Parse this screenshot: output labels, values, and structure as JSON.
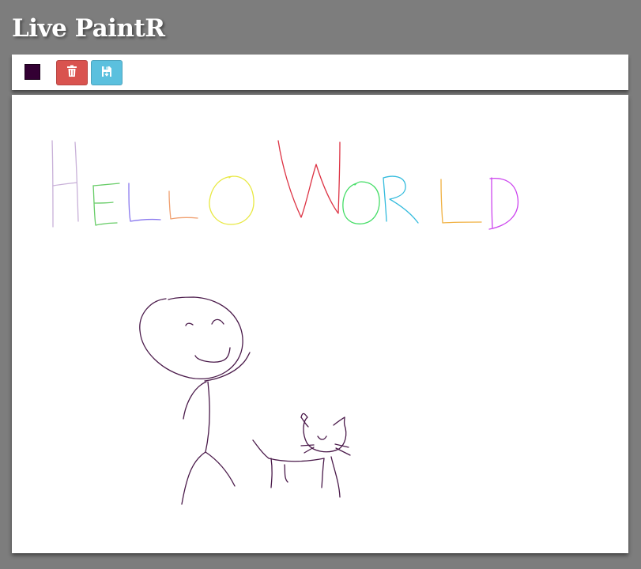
{
  "app": {
    "title": "Live PaintR"
  },
  "toolbar": {
    "current_color": "#330033",
    "clear_icon": "trash-icon",
    "clear_color": "#d9534f",
    "save_icon": "save-icon",
    "save_color": "#5bc0de"
  },
  "canvas": {
    "background": "#ffffff",
    "stroke_colors": {
      "H": "#c8b0d8",
      "E": "#66cc66",
      "L1": "#8877ee",
      "L2": "#f0a070",
      "O1": "#e8e840",
      "W": "#dd3344",
      "O2": "#44dd66",
      "R": "#33bbdd",
      "L3": "#f0b040",
      "D": "#cc44ee",
      "figure": "#4a1a4a"
    }
  }
}
